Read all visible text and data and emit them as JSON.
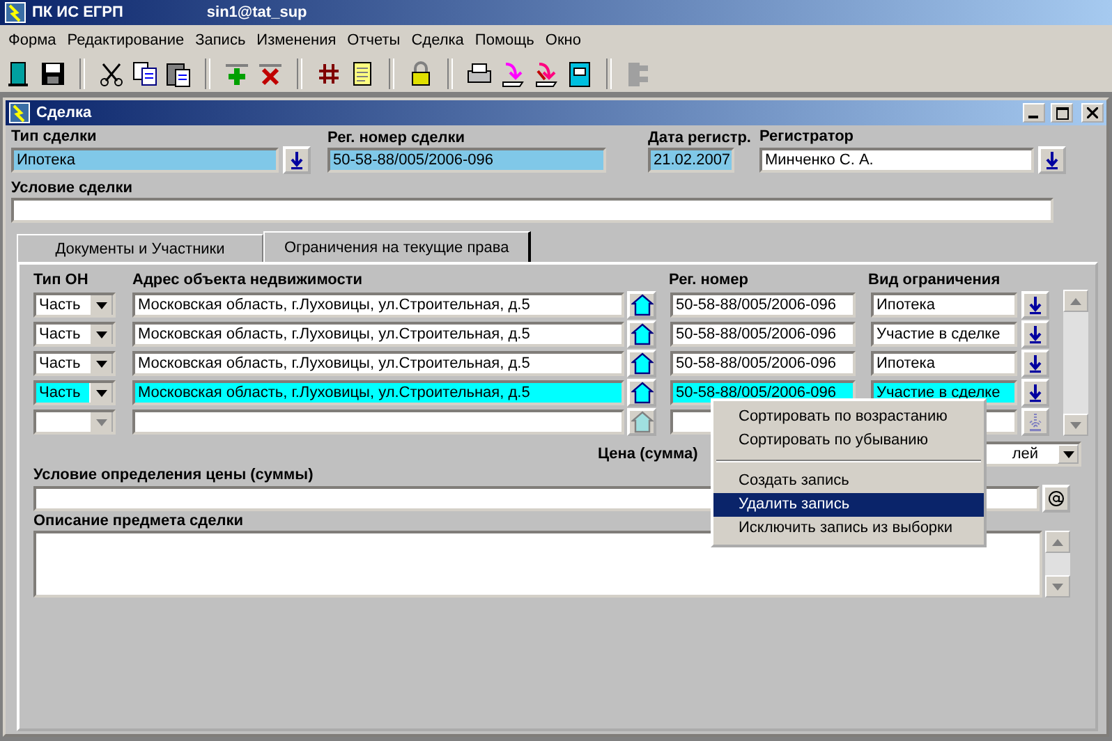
{
  "app": {
    "title": "ПК ИС ЕГРП",
    "user": "sin1@tat_sup"
  },
  "menu": [
    "Форма",
    "Редактирование",
    "Запись",
    "Изменения",
    "Отчеты",
    "Сделка",
    "Помощь",
    "Окно"
  ],
  "window": {
    "title": "Сделка"
  },
  "header": {
    "deal_type": {
      "label": "Тип сделки",
      "value": "Ипотека"
    },
    "reg_number": {
      "label": "Рег. номер сделки",
      "value": "50-58-88/005/2006-096"
    },
    "reg_date": {
      "label": "Дата регистр.",
      "value": "21.02.2007"
    },
    "registrar": {
      "label": "Регистратор",
      "value": "Минченко С. А."
    },
    "condition": {
      "label": "Условие сделки"
    }
  },
  "tabs": [
    {
      "label": "Документы и Участники",
      "selected": false
    },
    {
      "label": "Ограничения на текущие права",
      "selected": true
    }
  ],
  "grid": {
    "columns": [
      "Тип ОН",
      "Адрес объекта недвижимости",
      "Рег. номер",
      "Вид ограничения"
    ],
    "rows": [
      {
        "part": "Часть",
        "address": "Московская область, г.Луховицы, ул.Строительная, д.5",
        "reg_number": "50-58-88/005/2006-096",
        "restriction": "Ипотека",
        "selected": false,
        "disabled": false
      },
      {
        "part": "Часть",
        "address": "Московская область, г.Луховицы, ул.Строительная, д.5",
        "reg_number": "50-58-88/005/2006-096",
        "restriction": "Участие в сделке",
        "selected": false,
        "disabled": false
      },
      {
        "part": "Часть",
        "address": "Московская область, г.Луховицы, ул.Строительная, д.5",
        "reg_number": "50-58-88/005/2006-096",
        "restriction": "Ипотека",
        "selected": false,
        "disabled": false
      },
      {
        "part": "Часть",
        "address": "Московская область, г.Луховицы, ул.Строительная, д.5",
        "reg_number": "50-58-88/005/2006-096",
        "restriction": "Участие в сделке",
        "selected": true,
        "disabled": false
      },
      {
        "selected": false,
        "disabled": true
      }
    ]
  },
  "price": {
    "label": "Цена (сумма)",
    "currency": "лей"
  },
  "price_condition": {
    "label": "Условие определения цены (суммы)"
  },
  "description": {
    "label": "Описание предмета сделки"
  },
  "context_menu": [
    {
      "kind": "item",
      "label": "Сортировать по возрастанию",
      "selected": false
    },
    {
      "kind": "item",
      "label": "Сортировать по убыванию",
      "selected": false
    },
    {
      "kind": "separator"
    },
    {
      "kind": "item",
      "label": "Создать запись",
      "selected": false
    },
    {
      "kind": "item",
      "label": "Удалить запись",
      "selected": true
    },
    {
      "kind": "item",
      "label": "Исключить запись из выборки",
      "selected": false
    }
  ]
}
